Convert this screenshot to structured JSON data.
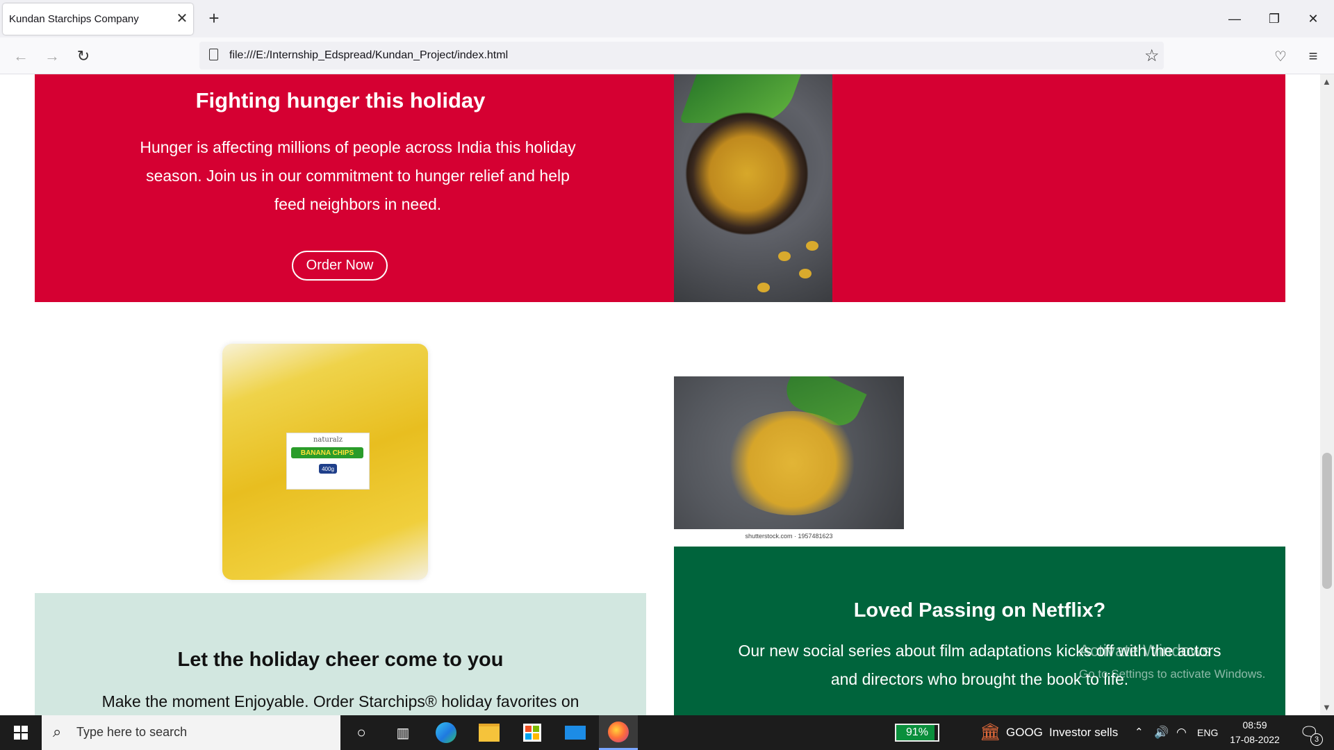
{
  "browser": {
    "tab_title": "Kundan Starchips Company",
    "tab_close": "✕",
    "new_tab": "+",
    "url": "file:///E:/Internship_Edspread/Kundan_Project/index.html",
    "window_controls": {
      "minimize": "—",
      "restore": "❐",
      "close": "✕"
    }
  },
  "hero": {
    "title": "Fighting hunger this holiday",
    "text": "Hunger is affecting millions of people across India this holiday season. Join us in our commitment to hunger relief and help feed neighbors in need.",
    "button": "Order Now",
    "bg_color": "#d50032"
  },
  "product_pack": {
    "brand": "naturalz",
    "name": "BANANA CHIPS",
    "weight": "400g"
  },
  "chips_image": {
    "credit": "shutterstock.com · 1957481623"
  },
  "cheer": {
    "title": "Let the holiday cheer come to you",
    "text": "Make the moment Enjoyable. Order Starchips® holiday favorites on",
    "bg_color": "#d2e7e0"
  },
  "netflix": {
    "title": "Loved Passing on Netflix?",
    "text": "Our new social series about film adaptations kicks off with the actors and directors who brought the book to life.",
    "bg_color": "#00643c"
  },
  "watermark": {
    "line1": "Activate Windows",
    "line2": "Go to Settings to activate Windows."
  },
  "taskbar": {
    "search_placeholder": "Type here to search",
    "battery_percent": 91,
    "battery_label": "91%",
    "stock_ticker": "GOOG",
    "stock_text": "Investor sells",
    "language": "ENG",
    "time": "08:59",
    "date": "17-08-2022",
    "notification_count": "3"
  }
}
